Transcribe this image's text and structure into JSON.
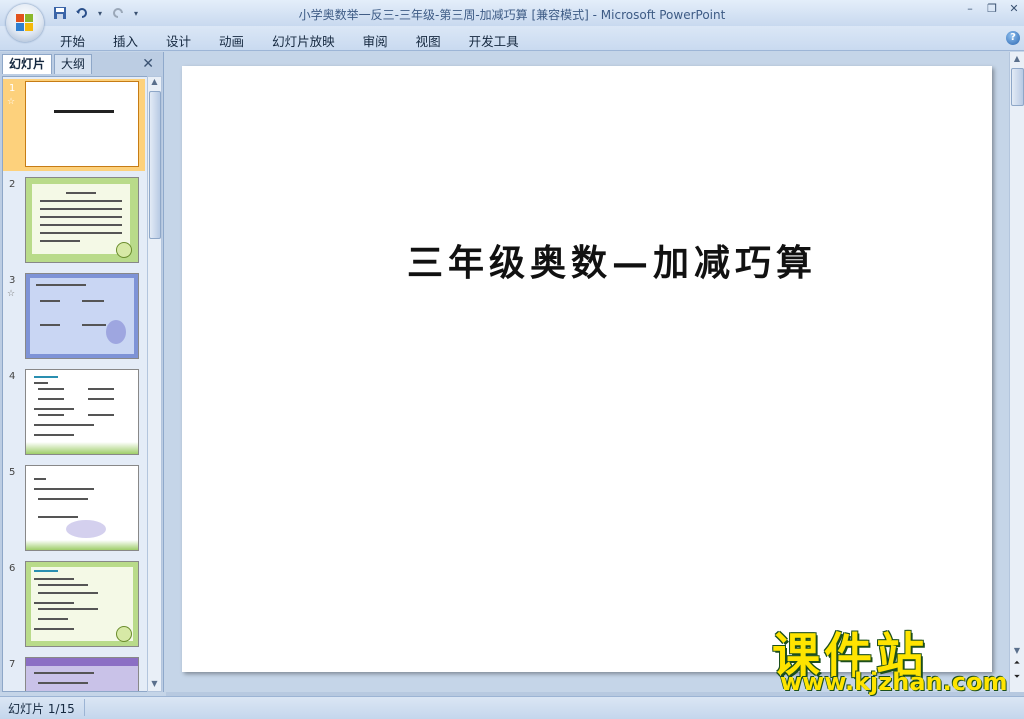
{
  "title_bar": {
    "title": "小学奥数举一反三-三年级-第三周-加减巧算 [兼容模式] - Microsoft PowerPoint"
  },
  "ribbon": {
    "tabs": [
      "开始",
      "插入",
      "设计",
      "动画",
      "幻灯片放映",
      "审阅",
      "视图",
      "开发工具"
    ]
  },
  "left_panel": {
    "tabs": [
      "幻灯片",
      "大纲"
    ],
    "selected_tab": "幻灯片",
    "slides": [
      {
        "number": "1",
        "selected": true,
        "star": true
      },
      {
        "number": "2",
        "selected": false,
        "star": false
      },
      {
        "number": "3",
        "selected": false,
        "star": true
      },
      {
        "number": "4",
        "selected": false,
        "star": false
      },
      {
        "number": "5",
        "selected": false,
        "star": false
      },
      {
        "number": "6",
        "selected": false,
        "star": false
      },
      {
        "number": "7",
        "selected": false,
        "star": false
      }
    ]
  },
  "slide": {
    "title": "三年级奥数—加减巧算"
  },
  "status_bar": {
    "slide_count": "幻灯片 1/15"
  },
  "watermark": {
    "cn": "课件站",
    "url": "www.kjzhan.com"
  },
  "colors": {
    "selected_thumb": "#fdd17c",
    "ribbon_bg": "#c9daf0",
    "watermark_yellow": "#ffe400"
  }
}
